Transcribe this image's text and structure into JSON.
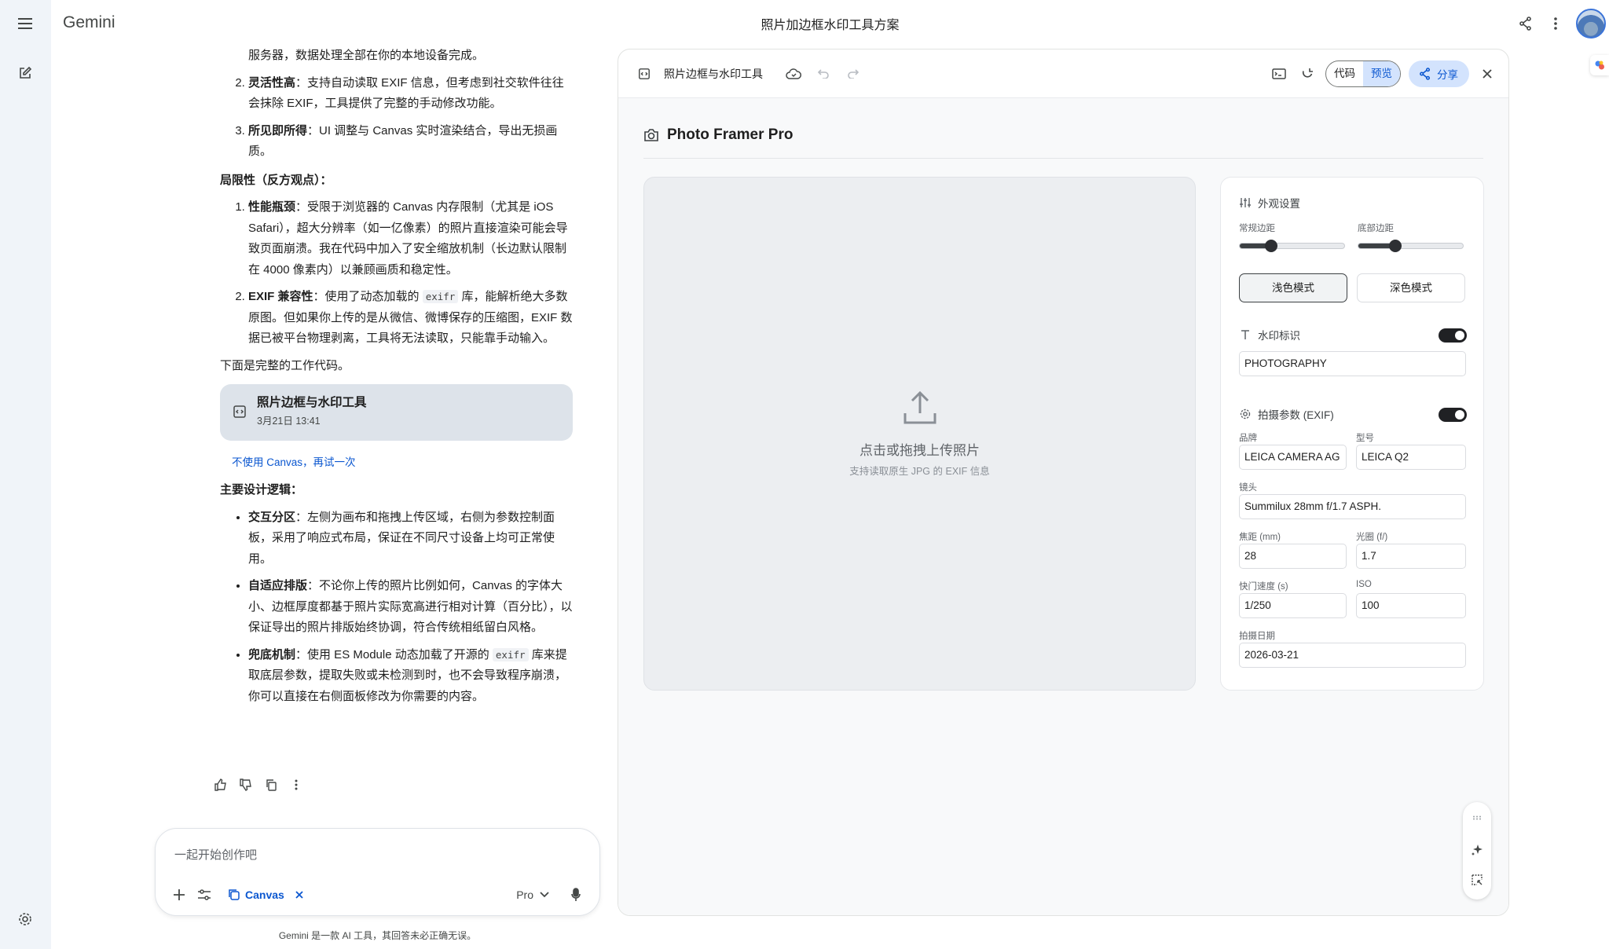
{
  "app": {
    "brand": "Gemini",
    "title": "照片加边框水印工具方案"
  },
  "chat": {
    "intro_tail": "服务器，数据处理全部在你的本地设备完成。",
    "advantages": [
      {
        "num": "2.",
        "bold": "灵活性高",
        "text": "：支持自动读取 EXIF 信息，但考虑到社交软件往往会抹除 EXIF，工具提供了完整的手动修改功能。"
      },
      {
        "num": "3.",
        "bold": "所见即所得",
        "text": "：UI 调整与 Canvas 实时渲染结合，导出无损画质。"
      }
    ],
    "limits_heading": "局限性（反方观点）：",
    "limit1_bold": "性能瓶颈",
    "limit1_text": "：受限于浏览器的 Canvas 内存限制（尤其是 iOS Safari），超大分辨率（如一亿像素）的照片直接渲染可能会导致页面崩溃。我在代码中加入了安全缩放机制（长边默认限制在 4000 像素内）以兼顾画质和稳定性。",
    "limit2_bold": "EXIF 兼容性",
    "limit2_pre": "：使用了动态加载的 ",
    "limit2_code": "exifr",
    "limit2_post": " 库，能解析绝大多数原图。但如果你上传的是从微信、微博保存的压缩图，EXIF 数据已被平台物理剥离，工具将无法读取，只能靠手动输入。",
    "code_intro": "下面是完整的工作代码。",
    "canvas_chip": {
      "title": "照片边框与水印工具",
      "time": "3月21日 13:41"
    },
    "retry_link": "不使用 Canvas，再试一次",
    "design_heading": "主要设计逻辑：",
    "design1_bold": "交互分区",
    "design1_text": "：左侧为画布和拖拽上传区域，右侧为参数控制面板，采用了响应式布局，保证在不同尺寸设备上均可正常使用。",
    "design2_bold": "自适应排版",
    "design2_text": "：不论你上传的照片比例如何，Canvas 的字体大小、边框厚度都基于照片实际宽高进行相对计算（百分比），以保证导出的照片排版始终协调，符合传统相纸留白风格。",
    "design3_bold": "兜底机制",
    "design3_pre": "：使用 ES Module 动态加载了开源的 ",
    "design3_code": "exifr",
    "design3_post": " 库来提取底层参数，提取失败或未检测到时，也不会导致程序崩溃，你可以直接在右侧面板修改为你需要的内容。"
  },
  "prompt": {
    "placeholder": "一起开始创作吧",
    "canvas_chip": "Canvas",
    "model": "Pro",
    "disclaimer": "Gemini 是一款 AI 工具，其回答未必正确无误。"
  },
  "panel": {
    "title": "照片边框与水印工具",
    "tab_code": "代码",
    "tab_preview": "预览",
    "share": "分享"
  },
  "framer": {
    "name": "Photo Framer Pro",
    "upload_title": "点击或拖拽上传照片",
    "upload_hint": "支持读取原生 JPG 的 EXIF 信息",
    "appearance": "外观设置",
    "margin_label": "常规边距",
    "bottom_label": "底部边距",
    "margin_value": 0.3,
    "bottom_value": 0.35,
    "light_mode": "浅色模式",
    "dark_mode": "深色模式",
    "watermark_label": "水印标识",
    "watermark_value": "PHOTOGRAPHY",
    "exif_label": "拍摄参数 (EXIF)",
    "brand_label": "品牌",
    "brand_value": "LEICA CAMERA AG",
    "model_label": "型号",
    "model_value": "LEICA Q2",
    "lens_label": "镜头",
    "lens_value": "Summilux 28mm f/1.7 ASPH.",
    "focal_label": "焦距 (mm)",
    "focal_value": "28",
    "aperture_label": "光圈 (f/)",
    "aperture_value": "1.7",
    "shutter_label": "快门速度 (s)",
    "shutter_value": "1/250",
    "iso_label": "ISO",
    "iso_value": "100",
    "date_label": "拍摄日期",
    "date_value": "2026-03-21"
  }
}
